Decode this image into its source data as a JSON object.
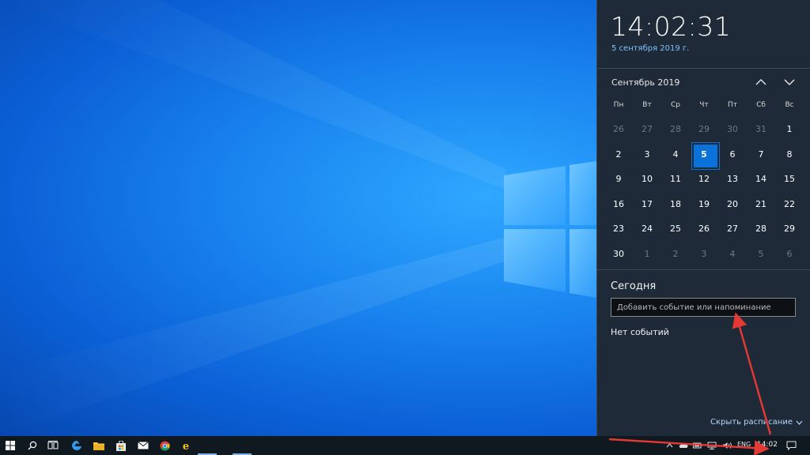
{
  "flyout": {
    "time": "14:02:31",
    "date_long": "5 сентября 2019 г.",
    "month_title": "Сентябрь 2019",
    "nav_up_icon": "chevron-up-icon",
    "nav_down_icon": "chevron-down-icon",
    "weekdays": [
      "Пн",
      "Вт",
      "Ср",
      "Чт",
      "Пт",
      "Сб",
      "Вс"
    ],
    "days": [
      {
        "d": "26",
        "other": true
      },
      {
        "d": "27",
        "other": true
      },
      {
        "d": "28",
        "other": true
      },
      {
        "d": "29",
        "other": true
      },
      {
        "d": "30",
        "other": true
      },
      {
        "d": "31",
        "other": true
      },
      {
        "d": "1",
        "other": false
      },
      {
        "d": "2",
        "other": false
      },
      {
        "d": "3",
        "other": false
      },
      {
        "d": "4",
        "other": false
      },
      {
        "d": "5",
        "other": false,
        "today": true
      },
      {
        "d": "6",
        "other": false
      },
      {
        "d": "7",
        "other": false
      },
      {
        "d": "8",
        "other": false
      },
      {
        "d": "9",
        "other": false
      },
      {
        "d": "10",
        "other": false
      },
      {
        "d": "11",
        "other": false
      },
      {
        "d": "12",
        "other": false
      },
      {
        "d": "13",
        "other": false
      },
      {
        "d": "14",
        "other": false
      },
      {
        "d": "15",
        "other": false
      },
      {
        "d": "16",
        "other": false
      },
      {
        "d": "17",
        "other": false
      },
      {
        "d": "18",
        "other": false
      },
      {
        "d": "19",
        "other": false
      },
      {
        "d": "20",
        "other": false
      },
      {
        "d": "21",
        "other": false
      },
      {
        "d": "22",
        "other": false
      },
      {
        "d": "23",
        "other": false
      },
      {
        "d": "24",
        "other": false
      },
      {
        "d": "25",
        "other": false
      },
      {
        "d": "26",
        "other": false
      },
      {
        "d": "27",
        "other": false
      },
      {
        "d": "28",
        "other": false
      },
      {
        "d": "29",
        "other": false
      },
      {
        "d": "30",
        "other": false
      },
      {
        "d": "1",
        "other": true
      },
      {
        "d": "2",
        "other": true
      },
      {
        "d": "3",
        "other": true
      },
      {
        "d": "4",
        "other": true
      },
      {
        "d": "5",
        "other": true
      },
      {
        "d": "6",
        "other": true
      }
    ],
    "today_title": "Сегодня",
    "event_placeholder": "Добавить событие или напоминание",
    "no_events": "Нет событий",
    "schedule_link": "Скрыть расписание"
  },
  "taskbar": {
    "icons": [
      "windows-start-icon",
      "search-icon",
      "task-view-icon",
      "edge-icon",
      "file-explorer-icon",
      "store-icon",
      "mail-icon",
      "chrome-icon",
      "ie-icon"
    ],
    "tray_icons": [
      "chevron-up-icon",
      "onedrive-icon",
      "battery-icon",
      "network-icon",
      "volume-icon"
    ],
    "language": "ENG",
    "clock": "14:02",
    "notification_icon": "action-center-icon"
  },
  "colors": {
    "accent": "#0a72d8",
    "flyout_bg": "#1f2a38",
    "taskbar_bg": "#101820",
    "arrow": "#e53935"
  }
}
